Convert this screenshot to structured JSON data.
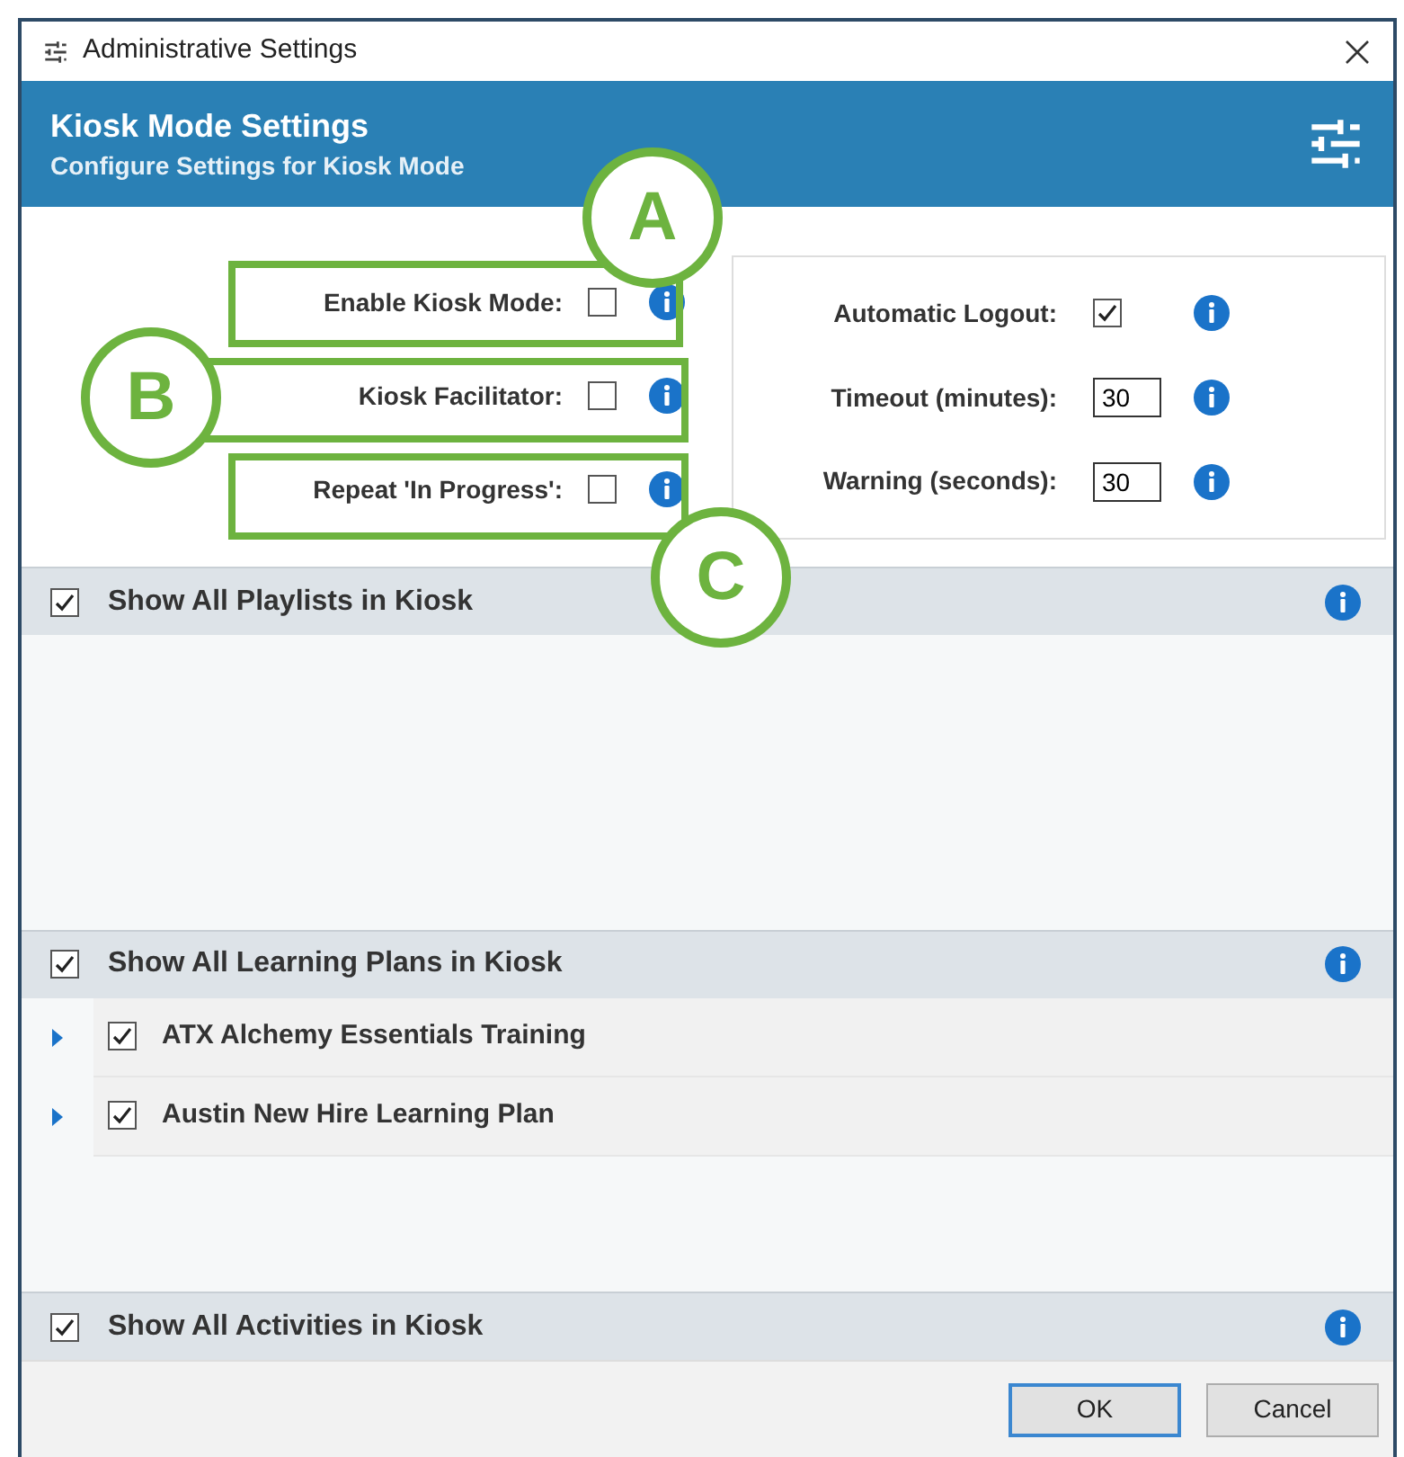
{
  "window": {
    "title": "Administrative Settings"
  },
  "header": {
    "title": "Kiosk Mode Settings",
    "subtitle": "Configure Settings for Kiosk Mode"
  },
  "kiosk_options": [
    {
      "label": "Enable Kiosk Mode:",
      "checked": false
    },
    {
      "label": "Kiosk Facilitator:",
      "checked": false
    },
    {
      "label": "Repeat 'In Progress':",
      "checked": false
    }
  ],
  "logout_options": [
    {
      "kind": "checkbox",
      "label": "Automatic Logout:",
      "checked": true
    },
    {
      "kind": "number",
      "label": "Timeout (minutes):",
      "value": "30"
    },
    {
      "kind": "number",
      "label": "Warning (seconds):",
      "value": "30"
    }
  ],
  "sections": [
    {
      "label": "Show All Playlists in Kiosk",
      "checked": true
    },
    {
      "label": "Show All Learning Plans in Kiosk",
      "checked": true,
      "items": [
        {
          "label": "ATX Alchemy Essentials Training",
          "checked": true,
          "expanded": false
        },
        {
          "label": "Austin New Hire Learning Plan",
          "checked": true,
          "expanded": false
        }
      ]
    },
    {
      "label": "Show All Activities in Kiosk",
      "checked": true
    }
  ],
  "annotations": [
    {
      "label": "A"
    },
    {
      "label": "B"
    },
    {
      "label": "C"
    }
  ],
  "buttons": [
    {
      "label": "OK",
      "default": true
    },
    {
      "label": "Cancel",
      "default": false
    }
  ]
}
